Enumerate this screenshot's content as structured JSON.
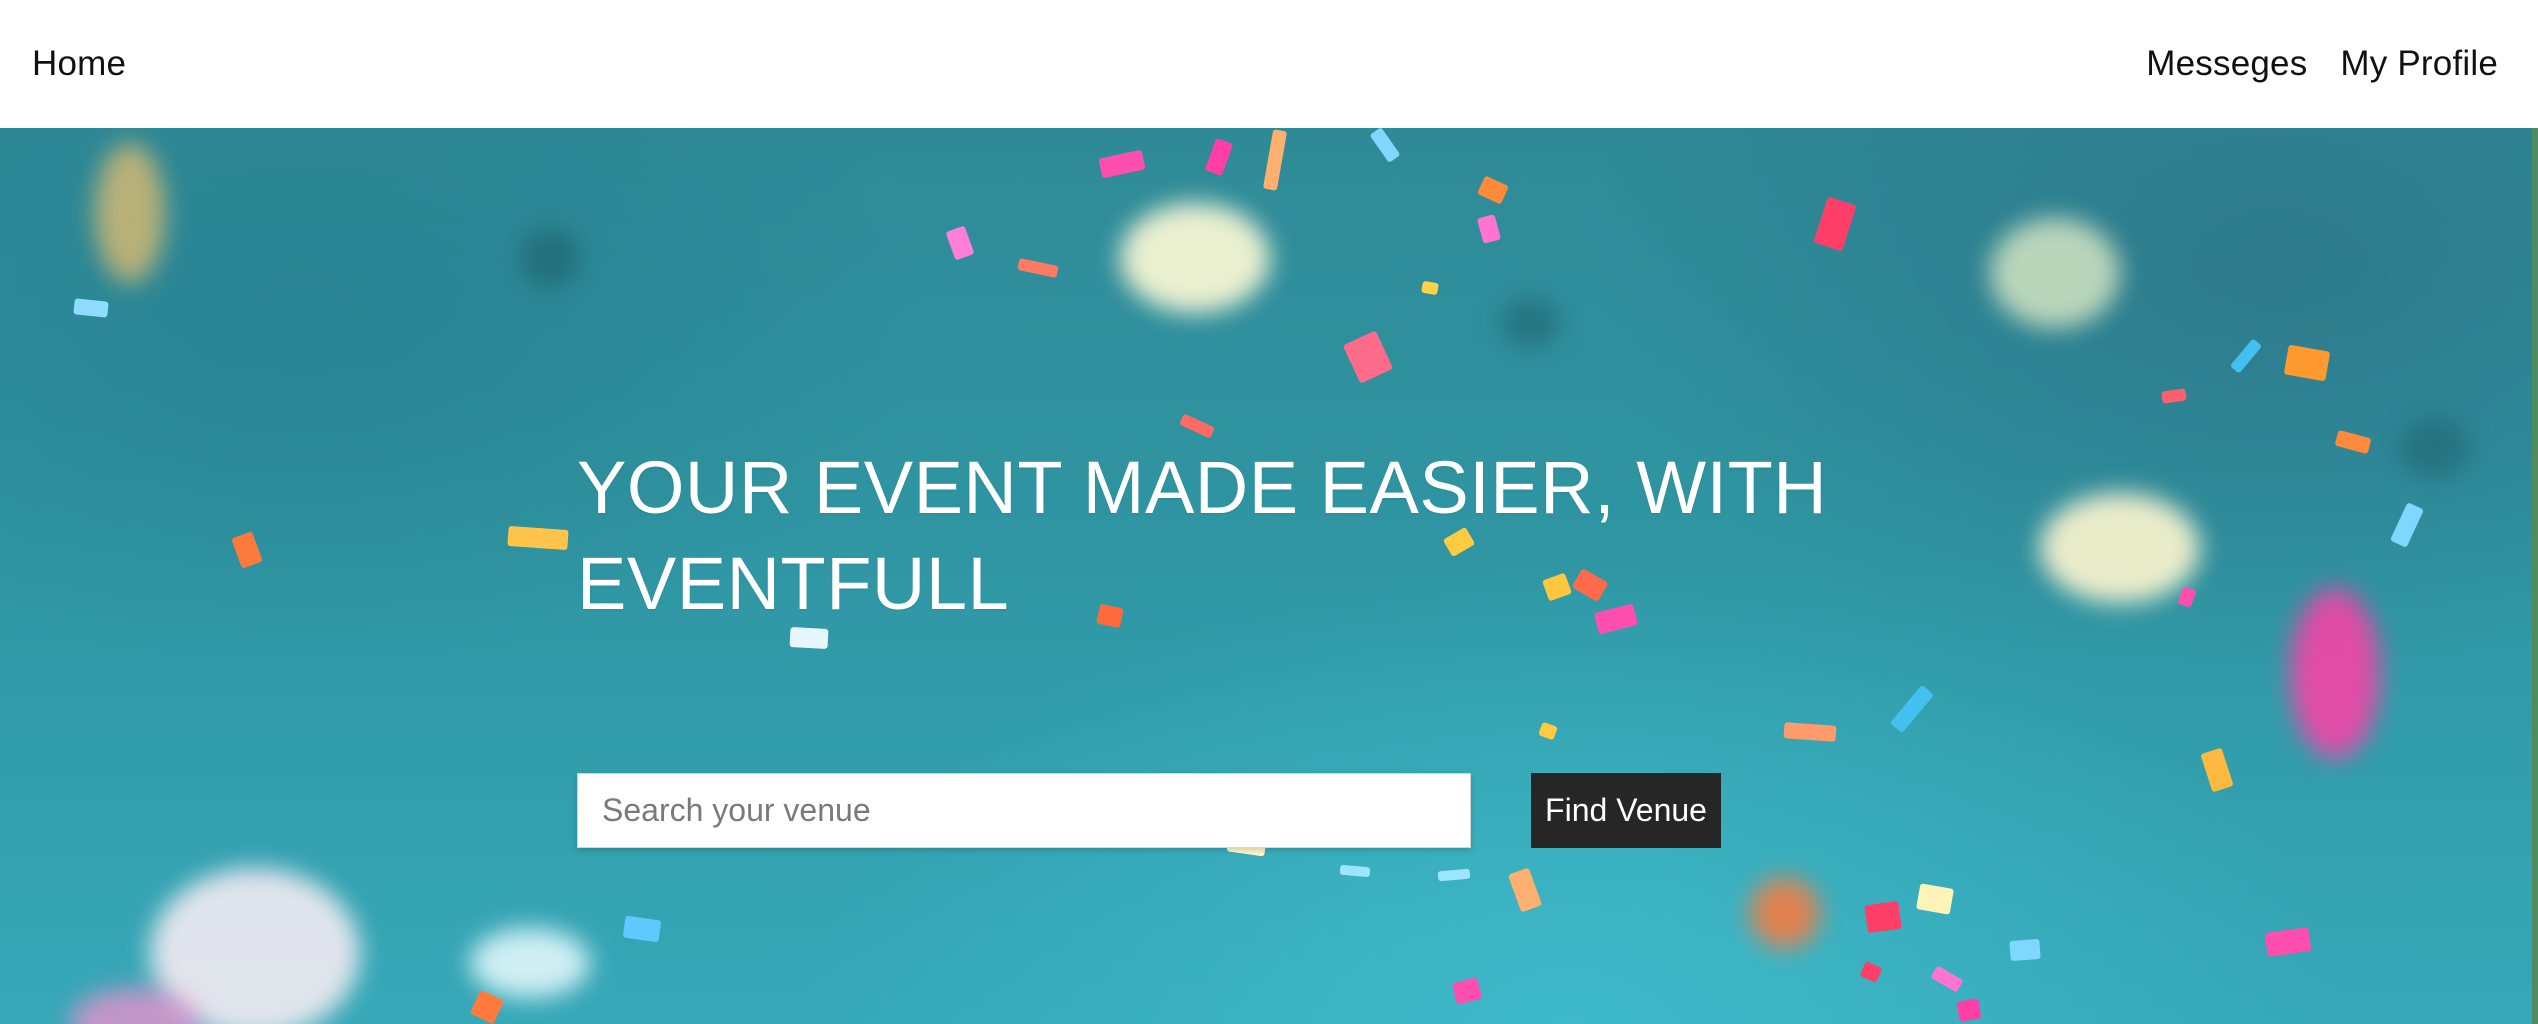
{
  "nav": {
    "home_label": "Home",
    "messages_label": "Messeges",
    "profile_label": "My Profile"
  },
  "hero": {
    "headline": "YOUR EVENT MADE EASIER, WITH EVENTFULL",
    "search": {
      "placeholder": "Search your venue",
      "value": ""
    },
    "find_label": "Find Venue"
  },
  "colors": {
    "hero_bg": "#2f95a2",
    "button_bg": "#262626",
    "nav_bg": "#ffffff"
  }
}
